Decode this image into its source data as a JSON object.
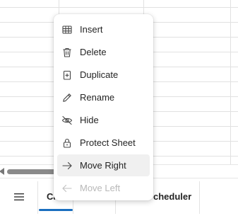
{
  "context_menu": {
    "items": [
      {
        "label": "Insert",
        "icon": "table-insert-icon"
      },
      {
        "label": "Delete",
        "icon": "trash-icon"
      },
      {
        "label": "Duplicate",
        "icon": "duplicate-icon"
      },
      {
        "label": "Rename",
        "icon": "pencil-icon"
      },
      {
        "label": "Hide",
        "icon": "eye-off-icon"
      },
      {
        "label": "Protect Sheet",
        "icon": "lock-icon"
      },
      {
        "label": "Move Right",
        "icon": "arrow-right-icon",
        "state": "hover"
      },
      {
        "label": "Move Left",
        "icon": "arrow-left-icon",
        "state": "disabled"
      }
    ]
  },
  "sheet_tabs": {
    "menu_icon": "hamburger-icon",
    "tabs": [
      {
        "label": "Ca",
        "active": true
      },
      {
        "label": "cheduler",
        "active": false
      }
    ]
  },
  "colors": {
    "active_tab_underline": "#1a6fbf",
    "menu_hover": "#f0f0f0",
    "disabled_text": "#b8b8b8"
  }
}
